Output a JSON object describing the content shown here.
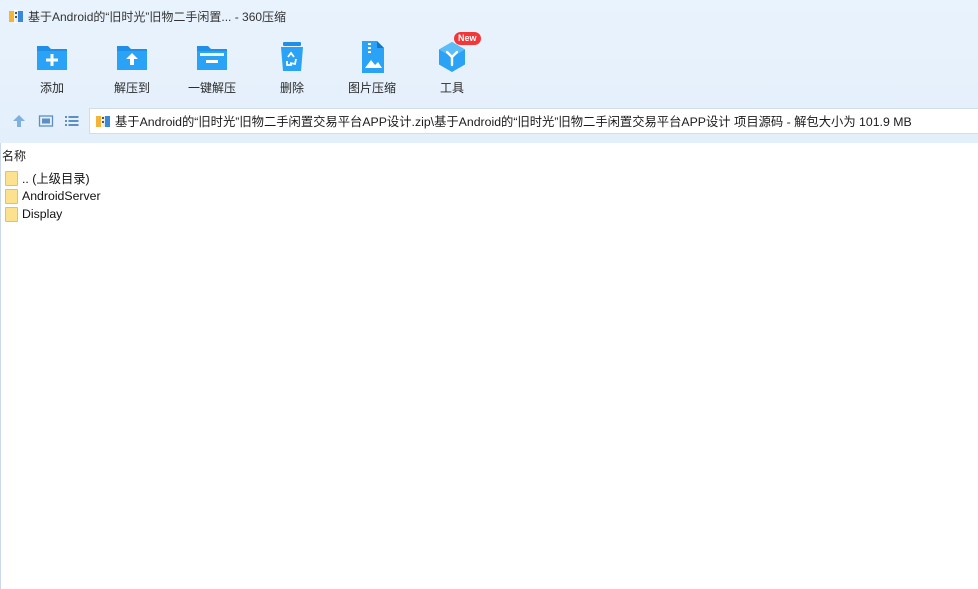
{
  "window": {
    "title": "基于Android的“旧时光”旧物二手闲置... - 360压缩",
    "app_icon": "archive-icon"
  },
  "toolbar": {
    "items": [
      {
        "label": "添加",
        "icon": "add-folder-icon"
      },
      {
        "label": "解压到",
        "icon": "extract-to-icon"
      },
      {
        "label": "一键解压",
        "icon": "one-click-extract-icon"
      },
      {
        "label": "删除",
        "icon": "recycle-bin-icon"
      },
      {
        "label": "图片压缩",
        "icon": "image-compress-icon"
      },
      {
        "label": "工具",
        "icon": "tools-cube-icon"
      }
    ],
    "new_badge": "New"
  },
  "nav": {
    "up_icon": "up-arrow-icon",
    "view_thumb_icon": "thumbnail-view-icon",
    "view_list_icon": "list-view-icon",
    "path": "基于Android的“旧时光”旧物二手闲置交易平台APP设计.zip\\基于Android的“旧时光”旧物二手闲置交易平台APP设计 项目源码 - 解包大小为 101.9 MB"
  },
  "file_list": {
    "column_name": "名称",
    "rows": [
      {
        "name": ".. (上级目录)",
        "icon": "folder-icon"
      },
      {
        "name": "AndroidServer",
        "icon": "folder-icon"
      },
      {
        "name": "Display",
        "icon": "folder-icon"
      }
    ]
  },
  "colors": {
    "accent_blue": "#1f9af0",
    "header_bg": "#e6f1fc",
    "badge_red": "#f2373b",
    "folder_yellow": "#fce18e"
  }
}
